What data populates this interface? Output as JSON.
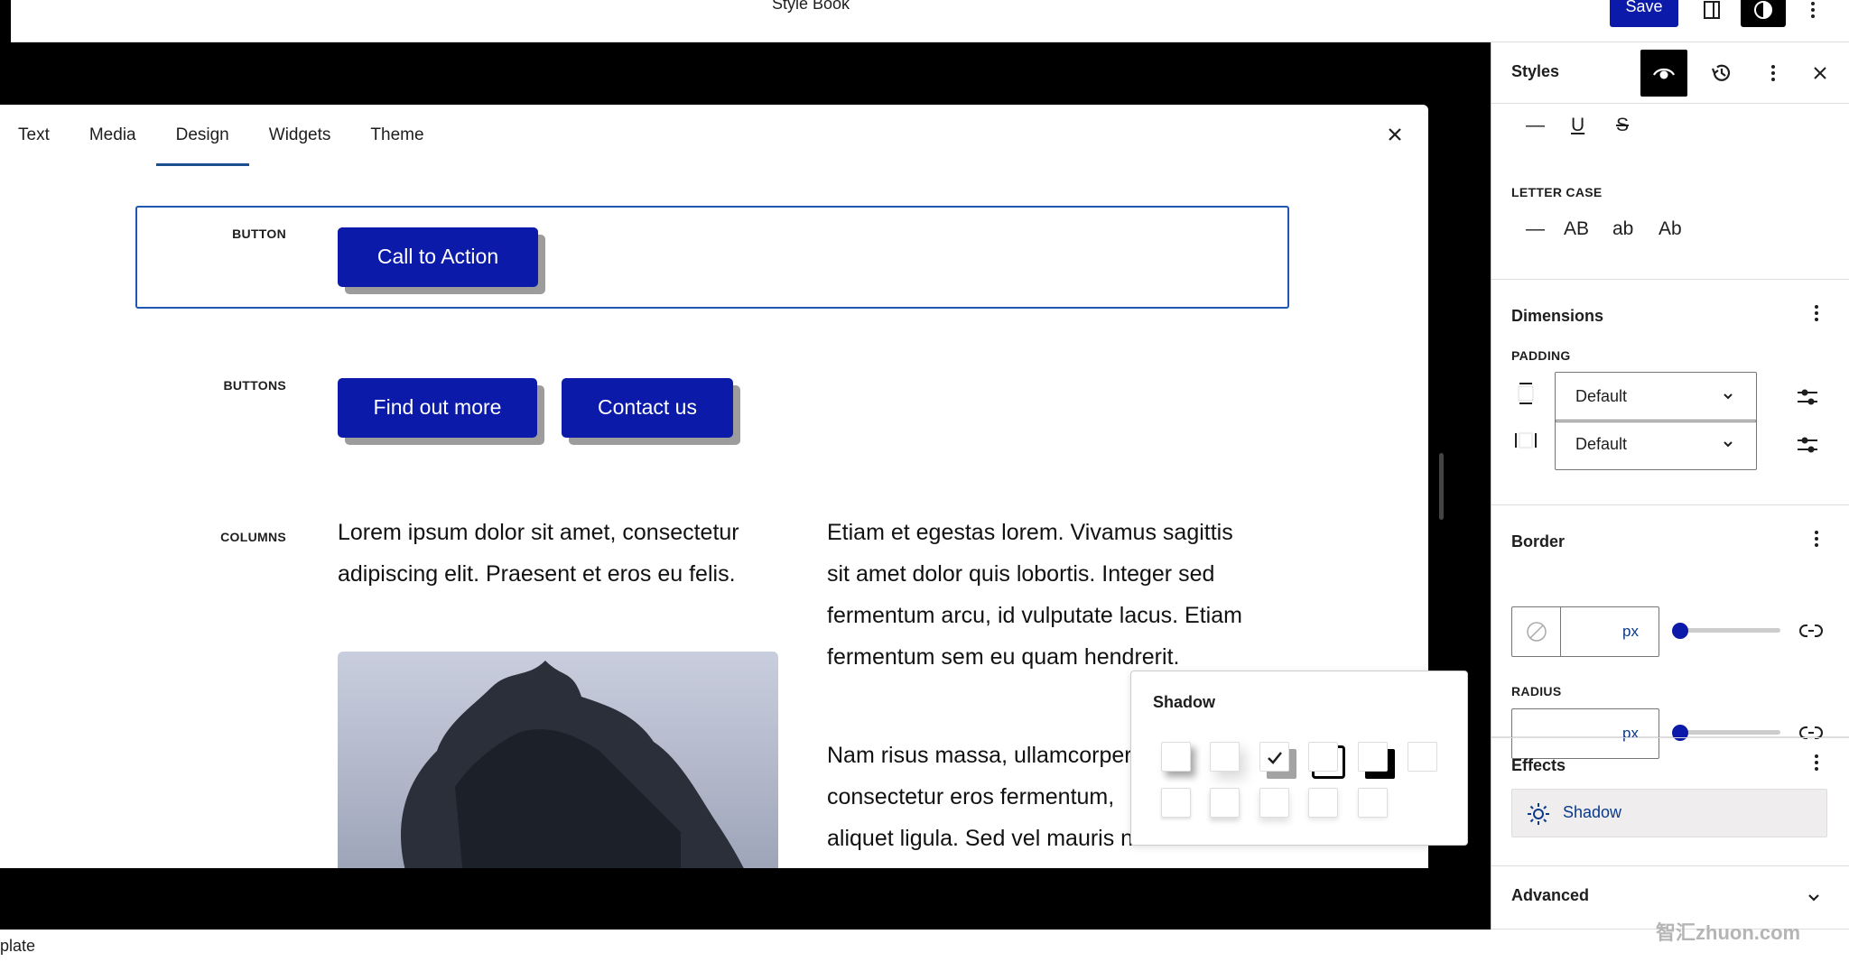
{
  "header": {
    "title": "Style Book",
    "save_label": "Save",
    "icons": [
      "sidebar-toggle-icon",
      "styles-contrast-icon",
      "more-options-icon"
    ]
  },
  "stylebook": {
    "tabs": [
      {
        "label": "Text",
        "active": false
      },
      {
        "label": "Media",
        "active": false
      },
      {
        "label": "Design",
        "active": true
      },
      {
        "label": "Widgets",
        "active": false
      },
      {
        "label": "Theme",
        "active": false
      }
    ],
    "close_icon": "close-icon",
    "sections": {
      "button": {
        "label": "BUTTON",
        "buttons": [
          "Call to Action"
        ]
      },
      "buttons": {
        "label": "BUTTONS",
        "buttons": [
          "Find out more",
          "Contact us"
        ]
      },
      "columns": {
        "label": "COLUMNS",
        "col1_lines": [
          "Lorem ipsum dolor sit amet, consectetur",
          "adipiscing elit. Praesent et eros eu felis."
        ],
        "col2_para1": [
          "Etiam et egestas lorem. Vivamus sagittis",
          "sit amet dolor quis lobortis. Integer sed",
          "fermentum arcu, id vulputate lacus. Etiam",
          "fermentum sem eu quam hendrerit."
        ],
        "col2_para2": [
          "Nam risus massa, ullamcorper",
          "consectetur eros fermentum,",
          "aliquet ligula. Sed vel mauris nec enim."
        ],
        "image_alt": "snow-covered tree against sky"
      }
    }
  },
  "sidebar": {
    "title": "Styles",
    "typography": {
      "decoration_options": [
        "—",
        "U",
        "S"
      ],
      "letter_case_label": "LETTER CASE",
      "letter_case_options": [
        "—",
        "AB",
        "ab",
        "Ab"
      ]
    },
    "dimensions": {
      "title": "Dimensions",
      "padding_label": "PADDING",
      "vertical_value": "Default",
      "horizontal_value": "Default"
    },
    "border": {
      "title": "Border",
      "width_unit": "px",
      "radius_label": "RADIUS",
      "radius_unit": "px",
      "width_slider_value": 0,
      "radius_slider_value": 0
    },
    "effects": {
      "title": "Effects",
      "shadow_label": "Shadow"
    },
    "advanced": {
      "title": "Advanced"
    }
  },
  "shadow_popover": {
    "title": "Shadow",
    "presets": [
      {
        "name": "natural",
        "selected": false
      },
      {
        "name": "deep",
        "selected": false
      },
      {
        "name": "sharp",
        "selected": true
      },
      {
        "name": "outlined",
        "selected": false
      },
      {
        "name": "crisp",
        "selected": false
      },
      {
        "name": "none",
        "selected": false
      },
      {
        "name": "custom-1",
        "selected": false
      },
      {
        "name": "custom-2",
        "selected": false
      },
      {
        "name": "custom-3",
        "selected": false
      },
      {
        "name": "custom-4",
        "selected": false
      },
      {
        "name": "custom-5",
        "selected": false
      }
    ]
  },
  "statusbar": {
    "text": "plate"
  },
  "watermark": "智汇zhuon.com",
  "colors": {
    "accent": "#0b1aa8",
    "selection": "#1e56b0",
    "link": "#0a3a8a"
  }
}
